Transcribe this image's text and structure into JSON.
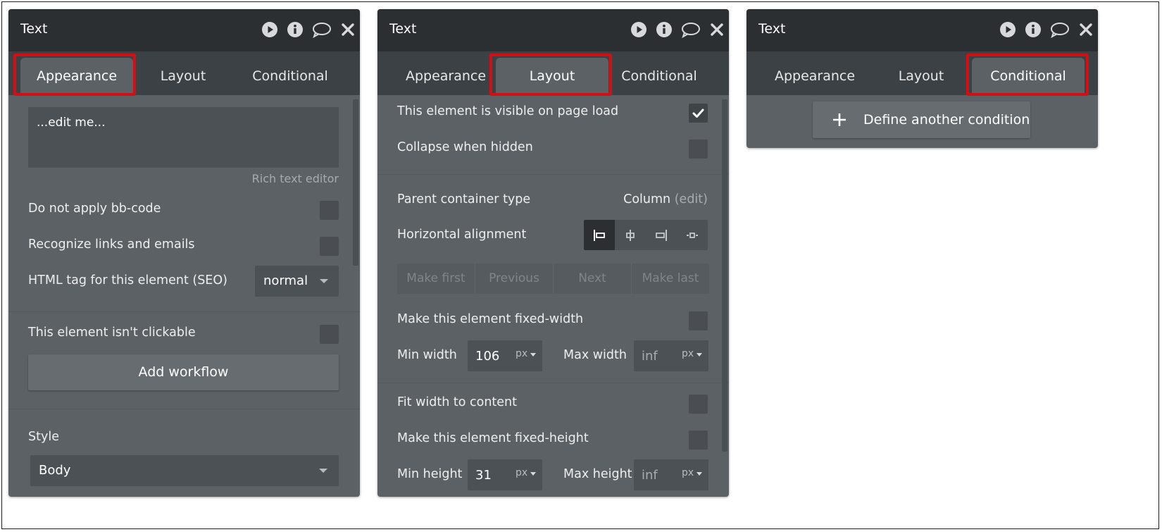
{
  "panels": [
    {
      "title": "Text",
      "tabs": [
        "Appearance",
        "Layout",
        "Conditional"
      ],
      "active_tab": "Appearance",
      "content": {
        "textarea_value": "...edit me...",
        "rich_text_link": "Rich text editor",
        "no_bbcode_label": "Do not apply bb-code",
        "recognize_links_label": "Recognize links and emails",
        "html_tag_label": "HTML tag for this element (SEO)",
        "html_tag_value": "normal",
        "not_clickable_label": "This element isn't clickable",
        "add_workflow_label": "Add workflow",
        "style_label": "Style",
        "style_value": "Body"
      }
    },
    {
      "title": "Text",
      "tabs": [
        "Appearance",
        "Layout",
        "Conditional"
      ],
      "active_tab": "Layout",
      "content": {
        "visible_on_load_label": "This element is visible on page load",
        "visible_on_load_checked": true,
        "collapse_hidden_label": "Collapse when hidden",
        "parent_container_label": "Parent container type",
        "parent_container_value": "Column",
        "parent_container_edit": "(edit)",
        "horizontal_alignment_label": "Horizontal alignment",
        "alignment_selected": "left",
        "reorder": [
          "Make first",
          "Previous",
          "Next",
          "Make last"
        ],
        "fixed_width_label": "Make this element fixed-width",
        "min_width_label": "Min width",
        "min_width_value": "106",
        "max_width_label": "Max width",
        "max_width_placeholder": "inf",
        "unit_label": "px",
        "fit_width_label": "Fit width to content",
        "fixed_height_label": "Make this element fixed-height",
        "min_height_label": "Min height",
        "min_height_value": "31",
        "max_height_label": "Max height",
        "max_height_placeholder": "inf"
      }
    },
    {
      "title": "Text",
      "tabs": [
        "Appearance",
        "Layout",
        "Conditional"
      ],
      "active_tab": "Conditional",
      "content": {
        "define_condition_label": "Define another condition"
      }
    }
  ],
  "header_icons": [
    "play-icon",
    "info-icon",
    "comment-icon",
    "close-icon"
  ],
  "colors": {
    "header_bg": "#2b2f32",
    "tabbar_bg": "#3c4145",
    "panel_bg": "#5c6166",
    "highlight": "#d10f14"
  }
}
